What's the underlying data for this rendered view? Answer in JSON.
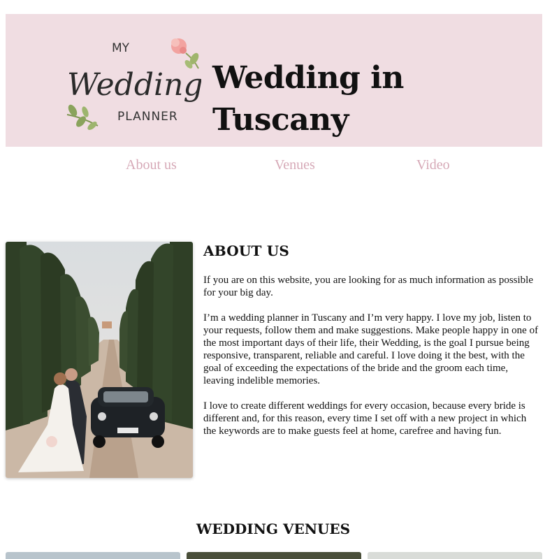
{
  "header": {
    "logo": {
      "top_text": "MY",
      "main_text": "Wedding",
      "bottom_text": "PLANNER"
    },
    "title": "Wedding in Tuscany"
  },
  "nav": {
    "items": [
      {
        "label": "About us"
      },
      {
        "label": "Venues"
      },
      {
        "label": "Video"
      }
    ]
  },
  "about": {
    "heading": "ABOUT US",
    "paragraphs": [
      "If you are on this website, you are looking for as much information as possible for your big day.",
      "I’m a wedding planner in Tuscany and I’m very happy. I love my job, listen to your requests, follow them and make suggestions. Make people happy in one of the most important days of their life, their Wedding, is the goal I pursue being responsive, transparent, reliable and careful. I love doing it the best, with the goal of exceeding the expectations of the bride and the groom each time, leaving indelible memories.",
      "I love to create different weddings for every occasion, because every bride is different and, for this reason, every time I set off with a new project in which the keywords are to make guests feel at home, carefree and having fun."
    ]
  },
  "venues": {
    "heading": "WEDDING VENUES"
  },
  "colors": {
    "header_bg": "#f0dde2",
    "nav_link": "#d6a9b7"
  }
}
